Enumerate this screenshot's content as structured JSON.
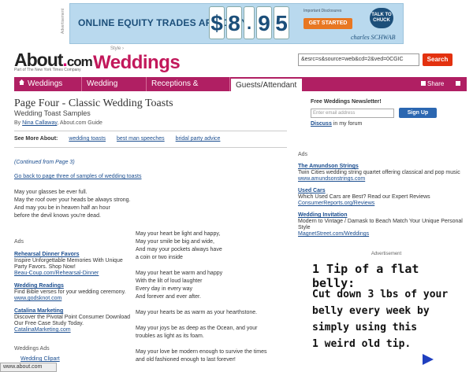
{
  "banner": {
    "label": "Advertisement",
    "headline": "ONLINE EQUITY TRADES ARE ONLY",
    "price_digits": [
      "$",
      "8",
      ".",
      "9",
      "5"
    ],
    "disclosure": "Important Disclosures",
    "cta": "GET STARTED",
    "bubble": "TALK TO CHUCK",
    "brand": "charles SCHWAB"
  },
  "header": {
    "logo_main": "About",
    "logo_dot": ".",
    "logo_com": "com",
    "tagline": "Part of The New York Times Company",
    "style": "Style ›",
    "section": "Weddings",
    "search_value": "&esrc=s&source=web&cd=2&ved=0CGIC",
    "search_button": "Search"
  },
  "nav": {
    "tabs": [
      "Weddings",
      "Wedding Planning",
      "Receptions & Parties",
      "Guests/Attendant"
    ],
    "share": "Share",
    "print_icon": "printer-icon"
  },
  "article": {
    "title": "Page Four - Classic Wedding Toasts",
    "subtitle": "Wedding Toast Samples",
    "by": "By",
    "author": "Nina Callaway",
    "source": ", About.com Guide",
    "see_more_label": "See More About:",
    "see_more_links": [
      "wedding toasts",
      "best man speeches",
      "bridal party advice"
    ],
    "continued": "(Continued from Page 3)",
    "go_back": "Go back to page three of samples of wedding toasts",
    "toast1": [
      "May your glasses be ever full.",
      "May the roof over your heads be always strong.",
      "And may you be in heaven half an hour",
      "before the devil knows you're dead."
    ],
    "poem": [
      [
        "May your heart be light and happy,",
        "May your smile be big and wide,",
        "And may your pockets always have",
        "a coin or two inside"
      ],
      [
        "May your heart be warm and happy",
        "With the lilt of loud laughter",
        "Every day in every way",
        "And forever and ever after."
      ],
      [
        "May your hearts be as warm as your hearthstone."
      ],
      [
        "May your joys be as deep as the Ocean, and your",
        "troubles as light as its foam."
      ],
      [
        "May your love be modern enough to survive the times",
        "and old fashioned enough to last forever!"
      ]
    ]
  },
  "newsletter": {
    "heading": "Free Weddings Newsletter!",
    "placeholder": "Enter email address",
    "button": "Sign Up",
    "discuss": "Discuss",
    "forum": " in my forum"
  },
  "left_ads": {
    "label": "Ads",
    "items": [
      {
        "title": "Rehearsal Dinner Favors",
        "desc": "Inspire Unforgettable Memories With Unique Party Favors. Shop Now!",
        "url": "Beau-Coup.com/Rehearsal-Dinner"
      },
      {
        "title": "Wedding Readings",
        "desc": "Find Bible verses for your wedding ceremony.",
        "url": "www.godsknot.com"
      },
      {
        "title": "Catalina Marketing",
        "desc": "Discover the Pivotal Point Consumer Download Our Free Case Study Today.",
        "url": "CatalinaMarketing.com"
      }
    ],
    "weddings_ads": "Weddings Ads",
    "clipart": "Wedding Clipart"
  },
  "right_ads": {
    "label": "Ads",
    "items": [
      {
        "title": "The Amundson Strings",
        "desc": "Twin Cities wedding string quartet offering classical and pop music",
        "url": "www.amundsonstrings.com"
      },
      {
        "title": "Used Cars",
        "desc": "Which Used Cars are Best? Read our Expert Reviews",
        "url": "ConsumerReports.org/Reviews"
      },
      {
        "title": "Wedding Invitation",
        "desc": "Modern to Vintage / Damask to Beach Match Your Unique Personal Style",
        "url": "MagnetStreet.com/Weddings"
      }
    ]
  },
  "hand_ad": {
    "label": "Advertisement",
    "headline": "1 Tip of a flat belly:",
    "body": [
      "Cut down 3 lbs of your",
      "belly every week by",
      "simply using this",
      "1 weird old tip."
    ]
  },
  "status_bar": "www.about.com"
}
